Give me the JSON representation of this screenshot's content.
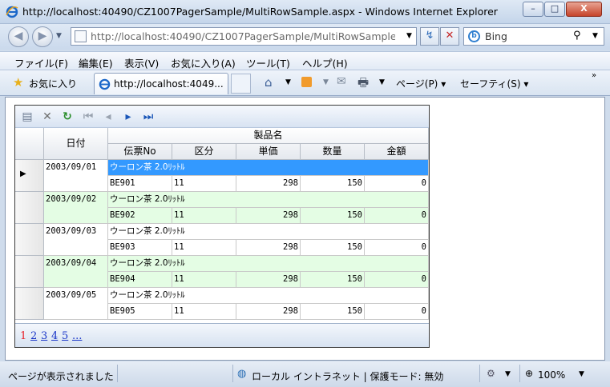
{
  "window": {
    "title": "http://localhost:40490/CZ1007PagerSample/MultiRowSample.aspx - Windows Internet Explorer",
    "minimize": "–",
    "maximize": "□",
    "close": "X"
  },
  "address": {
    "url": "http://localhost:40490/CZ1007PagerSample/MultiRowSample.aspx",
    "search_placeholder": "Bing"
  },
  "menu": [
    "ファイル(F)",
    "編集(E)",
    "表示(V)",
    "お気に入り(A)",
    "ツール(T)",
    "ヘルプ(H)"
  ],
  "favorites": {
    "label": "お気に入り",
    "tab_title": "http://localhost:4049...",
    "page_menu": "ページ(P)",
    "safety_menu": "セーフティ(S)"
  },
  "grid": {
    "headers": {
      "date": "日付",
      "product": "製品名",
      "slip": "伝票No",
      "category": "区分",
      "price": "単価",
      "qty": "数量",
      "amount": "金額"
    },
    "rows": [
      {
        "date": "2003/09/01",
        "product": "ウーロン茶 2.0ﾘｯﾄﾙ",
        "slip": "BE901",
        "category": "11",
        "price": "298",
        "qty": "150",
        "amount": "0",
        "selected": true
      },
      {
        "date": "2003/09/02",
        "product": "ウーロン茶 2.0ﾘｯﾄﾙ",
        "slip": "BE902",
        "category": "11",
        "price": "298",
        "qty": "150",
        "amount": "0",
        "selected": false
      },
      {
        "date": "2003/09/03",
        "product": "ウーロン茶 2.0ﾘｯﾄﾙ",
        "slip": "BE903",
        "category": "11",
        "price": "298",
        "qty": "150",
        "amount": "0",
        "selected": false
      },
      {
        "date": "2003/09/04",
        "product": "ウーロン茶 2.0ﾘｯﾄﾙ",
        "slip": "BE904",
        "category": "11",
        "price": "298",
        "qty": "150",
        "amount": "0",
        "selected": false
      },
      {
        "date": "2003/09/05",
        "product": "ウーロン茶 2.0ﾘｯﾄﾙ",
        "slip": "BE905",
        "category": "11",
        "price": "298",
        "qty": "150",
        "amount": "0",
        "selected": false
      }
    ],
    "pager": [
      "1",
      "2",
      "3",
      "4",
      "5",
      "..."
    ],
    "current_page": "1"
  },
  "status": {
    "text": "ページが表示されました",
    "zone": "ローカル イントラネット | 保護モード: 無効",
    "zoom": "100%"
  },
  "colors": {
    "selected": "#3399ff",
    "alt_row": "#e4fde4",
    "current_page": "#e8222a"
  }
}
